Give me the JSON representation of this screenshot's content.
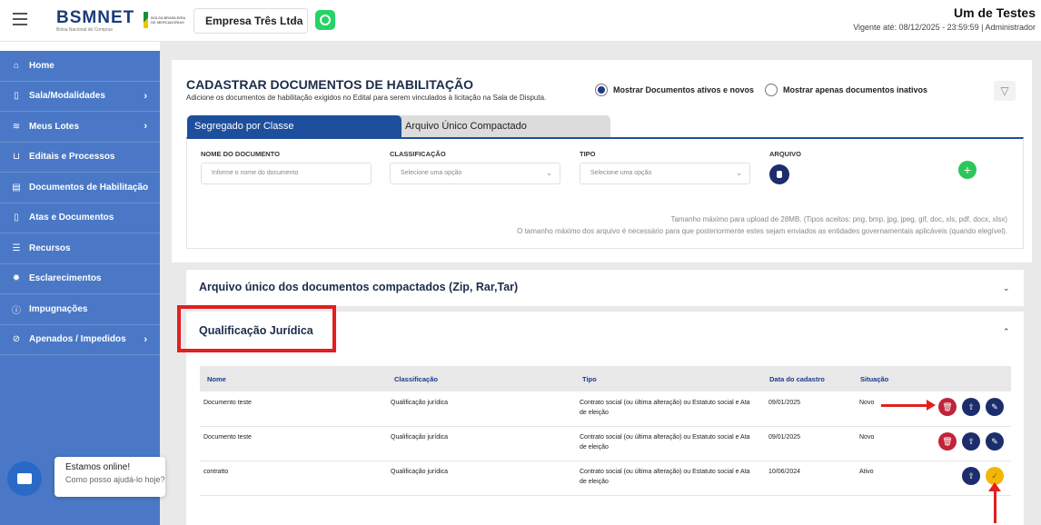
{
  "header": {
    "logo": "BSMNET",
    "logo_sub": "Bolsa Nacional de Compras",
    "bolsa_text": "BOLSA BRASILEIRA DE MERCADORIAS",
    "company": "Empresa Três Ltda",
    "user_name": "Um de Testes",
    "validity": "Vigente até: 08/12/2025 - 23:59:59 | Administrador"
  },
  "sidebar": {
    "items": [
      {
        "label": "Home",
        "icon": "home-icon",
        "glyph": "⌂"
      },
      {
        "label": "Sala/Modalidades",
        "icon": "chat-icon",
        "glyph": "▯"
      },
      {
        "label": "Meus Lotes",
        "icon": "layers-icon",
        "glyph": "≋"
      },
      {
        "label": "Editais e Processos",
        "icon": "cart-icon",
        "glyph": "⊔"
      },
      {
        "label": "Documentos de Habilitação",
        "icon": "document-icon",
        "glyph": "▤"
      },
      {
        "label": "Atas e Documentos",
        "icon": "file-icon",
        "glyph": "▯"
      },
      {
        "label": "Recursos",
        "icon": "list-icon",
        "glyph": "☰"
      },
      {
        "label": "Esclarecimentos",
        "icon": "bulb-icon",
        "glyph": "✹"
      },
      {
        "label": "Impugnações",
        "icon": "alert-icon",
        "glyph": "ⓘ"
      },
      {
        "label": "Apenados / Impedidos",
        "icon": "block-icon",
        "glyph": "⊘"
      }
    ]
  },
  "page": {
    "title": "CADASTRAR DOCUMENTOS DE HABILITAÇÃO",
    "subtitle": "Adicione os documentos de habilitação exigidos no Edital para serem vinculados à licitação na Sala de Disputa.",
    "radio_active": "Mostrar Documentos ativos e novos",
    "radio_inactive": "Mostrar apenas documentos inativos",
    "tabs": [
      "Segregado por Classe",
      "Arquivo Único Compactado"
    ]
  },
  "form": {
    "name_label": "NOME DO DOCUMENTO",
    "name_placeholder": "Informe o nome do documento",
    "class_label": "CLASSIFICAÇÃO",
    "class_value": "Selecione uma opção",
    "type_label": "TIPO",
    "type_value": "Selecione uma opção",
    "file_label": "ARQUIVO",
    "add": "+",
    "note1": "Tamanho máximo para upload de 28MB. (Tipos aceitos: png, bmp, jpg, jpeg, gif, doc, xls, pdf, docx, xlsx)",
    "note2": "O tamanho máximo dos arquivo é necessário para que posteriormente estes sejam enviados as entidades governamentais aplicáveis (quando elegível)."
  },
  "accordions": {
    "zip_title": "Arquivo único dos documentos compactados (Zip, Rar,Tar)",
    "qual_title": "Qualificação Jurídica"
  },
  "table": {
    "headers": [
      "Nome",
      "Classificação",
      "Tipo",
      "Data do cadastro",
      "Situação"
    ],
    "rows": [
      {
        "nome": "Documento teste",
        "classificacao": "Qualificação jurídica",
        "tipo": "Contrato social (ou última alteração) ou Estatuto social e Ata de eleição",
        "data": "09/01/2025",
        "situacao": "Novo"
      },
      {
        "nome": "Documento teste",
        "classificacao": "Qualificação jurídica",
        "tipo": "Contrato social (ou última alteração) ou Estatuto social e Ata de eleição",
        "data": "09/01/2025",
        "situacao": "Novo"
      },
      {
        "nome": "contratto",
        "classificacao": "Qualificação jurídica",
        "tipo": "Contrato social (ou última alteração) ou Estatuto social e Ata de eleição",
        "data": "10/06/2024",
        "situacao": "Ativo"
      }
    ]
  },
  "chat": {
    "online": "Estamos online!",
    "help": "Como posso ajudá-lo hoje?"
  },
  "colors": {
    "sidebar": "#4a78c6",
    "primary": "#1e4f9c",
    "annotation": "#e02020",
    "delete": "#c0243a",
    "action": "#1b2d6b",
    "highlight": "#f2b705"
  }
}
